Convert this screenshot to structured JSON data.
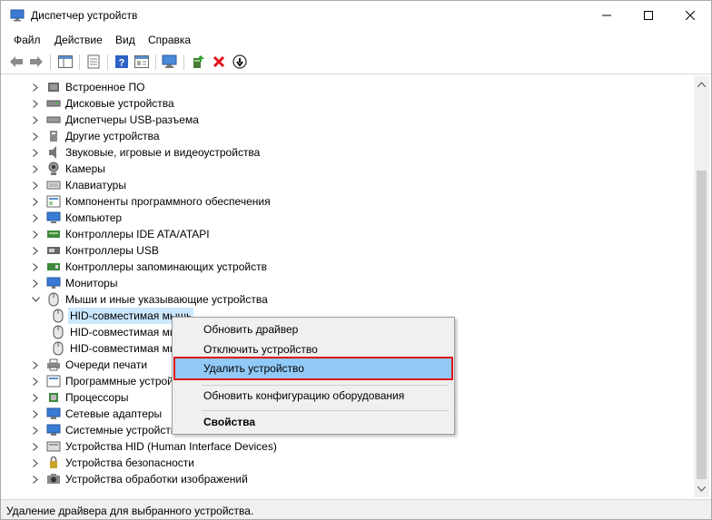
{
  "window": {
    "title": "Диспетчер устройств",
    "controls": {
      "minimize": "minimize-icon",
      "maximize": "maximize-icon",
      "close": "close-icon"
    }
  },
  "menu": [
    "Файл",
    "Действие",
    "Вид",
    "Справка"
  ],
  "toolbar": {
    "buttons": [
      "back-arrow-icon",
      "forward-arrow-icon",
      "show-hide-console-tree-icon",
      "properties-icon",
      "help-icon",
      "view-icon",
      "scan-hardware-icon",
      "update-driver-icon",
      "uninstall-device-icon",
      "disable-device-icon"
    ]
  },
  "tree": {
    "items": [
      {
        "label": "Встроенное ПО",
        "icon": "firmware-icon",
        "expanded": false,
        "level": 0
      },
      {
        "label": "Дисковые устройства",
        "icon": "disk-drive-icon",
        "expanded": false,
        "level": 0
      },
      {
        "label": "Диспетчеры USB-разъема",
        "icon": "usb-connector-icon",
        "expanded": false,
        "level": 0
      },
      {
        "label": "Другие устройства",
        "icon": "other-devices-icon",
        "expanded": false,
        "level": 0
      },
      {
        "label": "Звуковые, игровые и видеоустройства",
        "icon": "sound-icon",
        "expanded": false,
        "level": 0
      },
      {
        "label": "Камеры",
        "icon": "camera-icon",
        "expanded": false,
        "level": 0
      },
      {
        "label": "Клавиатуры",
        "icon": "keyboard-icon",
        "expanded": false,
        "level": 0
      },
      {
        "label": "Компоненты программного обеспечения",
        "icon": "software-component-icon",
        "expanded": false,
        "level": 0
      },
      {
        "label": "Компьютер",
        "icon": "computer-icon",
        "expanded": false,
        "level": 0
      },
      {
        "label": "Контроллеры IDE ATA/ATAPI",
        "icon": "ide-controller-icon",
        "expanded": false,
        "level": 0
      },
      {
        "label": "Контроллеры USB",
        "icon": "usb-controller-icon",
        "expanded": false,
        "level": 0
      },
      {
        "label": "Контроллеры запоминающих устройств",
        "icon": "storage-controller-icon",
        "expanded": false,
        "level": 0
      },
      {
        "label": "Мониторы",
        "icon": "monitor-icon",
        "expanded": false,
        "level": 0
      },
      {
        "label": "Мыши и иные указывающие устройства",
        "icon": "mouse-icon",
        "expanded": true,
        "level": 0
      },
      {
        "label": "HID-совместимая мышь",
        "icon": "mouse-icon",
        "level": 1,
        "selected": true
      },
      {
        "label": "HID-совместимая мышь",
        "icon": "mouse-icon",
        "level": 1
      },
      {
        "label": "HID-совместимая мышь",
        "icon": "mouse-icon",
        "level": 1
      },
      {
        "label": "Очереди печати",
        "icon": "print-queue-icon",
        "expanded": false,
        "level": 0
      },
      {
        "label": "Программные устройства",
        "icon": "software-device-icon",
        "expanded": false,
        "level": 0
      },
      {
        "label": "Процессоры",
        "icon": "processor-icon",
        "expanded": false,
        "level": 0
      },
      {
        "label": "Сетевые адаптеры",
        "icon": "network-adapter-icon",
        "expanded": false,
        "level": 0
      },
      {
        "label": "Системные устройства",
        "icon": "system-device-icon",
        "expanded": false,
        "level": 0
      },
      {
        "label": "Устройства HID (Human Interface Devices)",
        "icon": "hid-icon",
        "expanded": false,
        "level": 0
      },
      {
        "label": "Устройства безопасности",
        "icon": "security-device-icon",
        "expanded": false,
        "level": 0
      },
      {
        "label": "Устройства обработки изображений",
        "icon": "imaging-device-icon",
        "expanded": false,
        "level": 0
      }
    ]
  },
  "context_menu": {
    "items": [
      {
        "label": "Обновить драйвер"
      },
      {
        "label": "Отключить устройство"
      },
      {
        "label": "Удалить устройство",
        "highlighted": true
      },
      {
        "separator": true
      },
      {
        "label": "Обновить конфигурацию оборудования"
      },
      {
        "separator": true
      },
      {
        "label": "Свойства",
        "bold": true
      }
    ]
  },
  "status_bar": {
    "text": "Удаление драйвера для выбранного устройства."
  },
  "colors": {
    "selection": "#cce8ff",
    "menu_highlight": "#91c9f7",
    "highlight_border": "#e0121a",
    "uninstall_red": "#e0121a"
  }
}
